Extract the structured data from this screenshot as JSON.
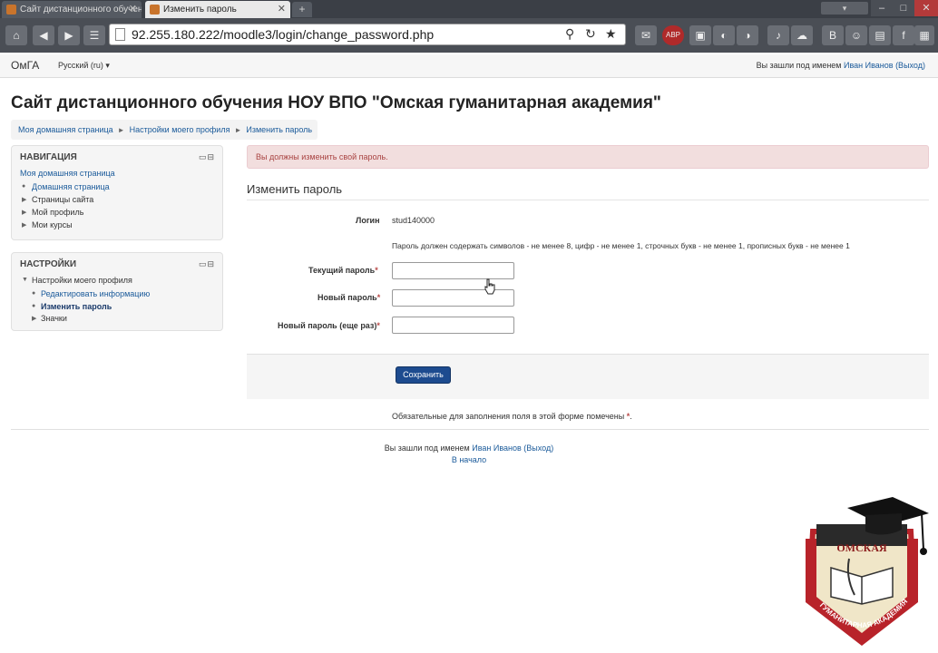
{
  "browser": {
    "tabs": [
      {
        "label": "Сайт дистанционного обучения",
        "active": false
      },
      {
        "label": "Изменить пароль",
        "active": true
      }
    ],
    "url": "92.255.180.222/moodle3/login/change_password.php"
  },
  "topnav": {
    "brand": "ОмГА",
    "language": "Русский (ru)",
    "login_prefix": "Вы зашли под именем",
    "user_name": "Иван Иванов",
    "logout": "(Выход)"
  },
  "site_title": "Сайт дистанционного обучения НОУ ВПО \"Омская гуманитарная академия\"",
  "breadcrumb": [
    "Моя домашняя страница",
    "Настройки моего профиля",
    "Изменить пароль"
  ],
  "nav_block": {
    "title": "НАВИГАЦИЯ",
    "home": "Моя домашняя страница",
    "items": [
      "Домашняя страница",
      "Страницы сайта",
      "Мой профиль",
      "Мои курсы"
    ]
  },
  "settings_block": {
    "title": "НАСТРОЙКИ",
    "group": "Настройки моего профиля",
    "items": [
      "Редактировать информацию",
      "Изменить пароль",
      "Значки"
    ]
  },
  "alert": "Вы должны изменить свой пароль.",
  "form": {
    "title": "Изменить пароль",
    "login_label": "Логин",
    "login_value": "stud140000",
    "policy": "Пароль должен содержать символов - не менее 8, цифр - не менее 1, строчных букв - не менее 1, прописных букв - не менее 1",
    "current_label": "Текущий пароль",
    "new_label": "Новый пароль",
    "repeat_label": "Новый пароль (еще раз)",
    "required_mark": "*",
    "save": "Сохранить",
    "required_note": "Обязательные для заполнения поля в этой форме помечены"
  },
  "footer": {
    "login_prefix": "Вы зашли под именем",
    "user_name": "Иван Иванов",
    "logout": "(Выход)",
    "home": "В начало"
  },
  "emblem": {
    "top_text": "ОМСКАЯ",
    "bottom_text": "ГУМАНИТАРНАЯ АКАДЕМИЯ"
  }
}
